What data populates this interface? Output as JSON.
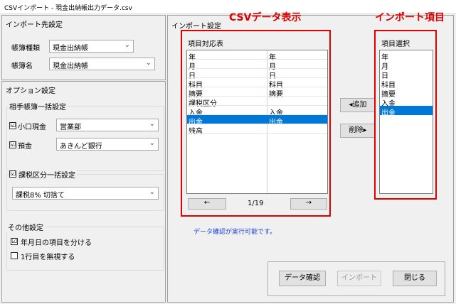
{
  "window_title": "CSVインポート - 現金出納帳出力データ.csv",
  "import_target": {
    "group_label": "インポート先設定",
    "book_type_label": "帳簿種類",
    "book_type_value": "現金出納帳",
    "book_name_label": "帳簿名",
    "book_name_value": "現金出納帳"
  },
  "options": {
    "group_label": "オプション設定",
    "counter_group_label": "相手帳簿一括設定",
    "petty_cash_label": "小口現金",
    "petty_cash_checked": "☑",
    "petty_cash_value": "営業部",
    "deposit_label": "預金",
    "deposit_checked": "☑",
    "deposit_value": "あきんど銀行",
    "tax_group_label": "課税区分一括設定",
    "tax_checked": "☑",
    "tax_value": "課税8% 切捨て",
    "other_group_label": "その他設定",
    "split_date_label": "年月日の項目を分ける",
    "split_date_checked": "☑",
    "ignore_first_label": "1行目を無視する",
    "ignore_first_checked": ""
  },
  "import_settings": {
    "group_label": "インポート設定",
    "csv_display_title": "CSVデータ表示",
    "import_items_title": "インポート項目",
    "mapping_label": "項目対応表",
    "mapping_rows": [
      {
        "a": "年",
        "b": "年",
        "selected": false
      },
      {
        "a": "月",
        "b": "月",
        "selected": false
      },
      {
        "a": "日",
        "b": "日",
        "selected": false
      },
      {
        "a": "科目",
        "b": "科目",
        "selected": false
      },
      {
        "a": "摘要",
        "b": "摘要",
        "selected": false
      },
      {
        "a": "課税区分",
        "b": "",
        "selected": false
      },
      {
        "a": "入金",
        "b": "入金",
        "selected": false
      },
      {
        "a": "出金",
        "b": "出金",
        "selected": true
      },
      {
        "a": "残高",
        "b": "",
        "selected": false
      }
    ],
    "prev_arrow": "←",
    "next_arrow": "→",
    "page_indicator": "1/19",
    "item_select_label": "項目選択",
    "select_items": [
      {
        "label": "年",
        "selected": false
      },
      {
        "label": "月",
        "selected": false
      },
      {
        "label": "日",
        "selected": false
      },
      {
        "label": "科目",
        "selected": false
      },
      {
        "label": "摘要",
        "selected": false
      },
      {
        "label": "入金",
        "selected": false
      },
      {
        "label": "出金",
        "selected": true
      }
    ],
    "add_button": "◂追加",
    "remove_button": "削除▸",
    "status_message": "データ確認が実行可能です。"
  },
  "footer": {
    "check_button": "データ確認",
    "import_button": "インポート",
    "close_button": "閉じる"
  },
  "colors": {
    "accent_red": "#e00000",
    "selection_blue": "#0078d7",
    "status_blue": "#1a3fd6"
  }
}
